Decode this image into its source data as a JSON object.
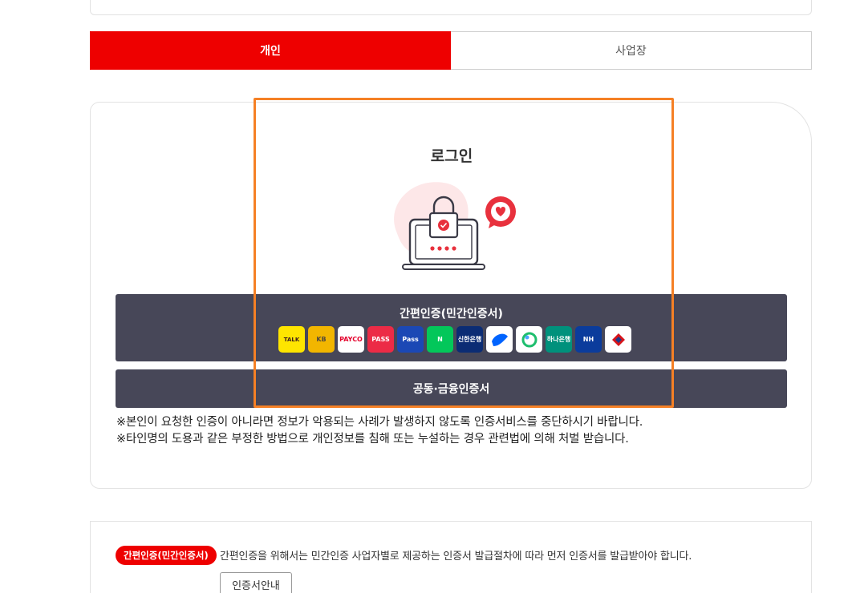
{
  "tabs": [
    {
      "label": "개인",
      "active": true
    },
    {
      "label": "사업장",
      "active": false
    }
  ],
  "login": {
    "title": "로그인",
    "simple_auth_label": "간편인증(민간인증서)",
    "cert_label": "공동·금융인증서",
    "providers": [
      {
        "name": "kakao-talk",
        "text": "TALK",
        "bg": "#fee500",
        "fg": "#3c1e1e"
      },
      {
        "name": "kb-bank",
        "text": "KB",
        "bg": "#f2b600",
        "fg": "#544a3a"
      },
      {
        "name": "payco",
        "text": "PAYCO",
        "bg": "#ffffff",
        "fg": "#e4002b"
      },
      {
        "name": "pass",
        "text": "PASS",
        "bg": "#ec2b46",
        "fg": "#ffffff"
      },
      {
        "name": "samsung-pass",
        "text": "Pass",
        "bg": "#1b48b5",
        "fg": "#ffffff"
      },
      {
        "name": "naver",
        "text": "N",
        "bg": "#03c75a",
        "fg": "#ffffff"
      },
      {
        "name": "shinhan-bank",
        "text": "신한은행",
        "bg": "#0b2c74",
        "fg": "#ffffff"
      },
      {
        "name": "toss",
        "text": "",
        "bg": "#ffffff",
        "fg": "#0064ff"
      },
      {
        "name": "banksalad",
        "text": "",
        "bg": "#ffffff",
        "fg": "#1ebe6e"
      },
      {
        "name": "hana-bank",
        "text": "하나은행",
        "bg": "#00917c",
        "fg": "#ffffff"
      },
      {
        "name": "nh-bank",
        "text": "NH",
        "bg": "#0b3c9c",
        "fg": "#ffffff"
      },
      {
        "name": "woori-bank",
        "text": "",
        "bg": "#ffffff",
        "fg": "#d7141a"
      }
    ],
    "notices": [
      "※본인이 요청한 인증이 아니라면 정보가 악용되는 사례가 발생하지 않도록 인증서비스를 중단하시기 바랍니다.",
      "※타인명의 도용과 같은 부정한 방법으로 개인정보를 침해 또는 누설하는 경우 관련법에 의해 처벌 받습니다."
    ]
  },
  "info": {
    "badge": "간편인증(민간인증서)",
    "text": "간편인증을 위해서는 민간인증 사업자별로 제공하는 인증서 발급절차에 따라 먼저 인증서를 발급받아야 합니다.",
    "guide_button": "인증서안내"
  },
  "colors": {
    "brand_red": "#ee0000",
    "button_dark": "#474758",
    "highlight": "#f58025"
  }
}
